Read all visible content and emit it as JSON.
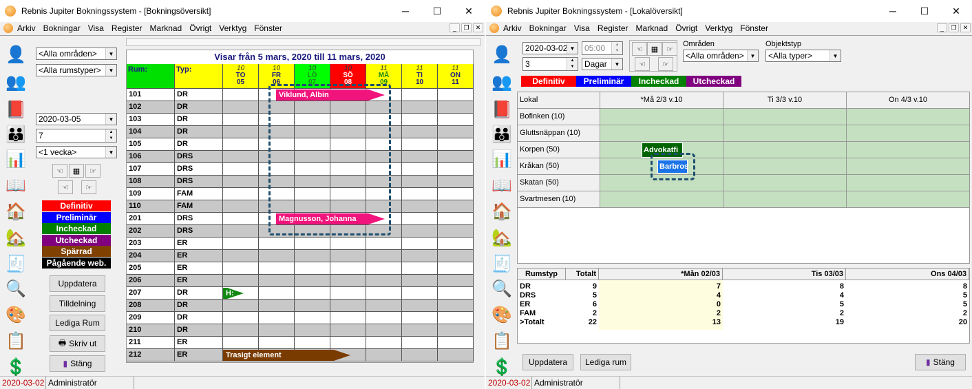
{
  "w1": {
    "title": "Rebnis Jupiter Bokningssystem - [Bokningsöversikt]",
    "menu": [
      "Arkiv",
      "Bokningar",
      "Visa",
      "Register",
      "Marknad",
      "Övrigt",
      "Verktyg",
      "Fönster"
    ],
    "filter_area": "<Alla områden>",
    "filter_roomtype": "<Alla rumstyper>",
    "date": "2020-03-05",
    "days": "7",
    "period": "<1 vecka>",
    "legend": [
      {
        "label": "Definitiv",
        "color": "#ff0000"
      },
      {
        "label": "Preliminär",
        "color": "#0000ff"
      },
      {
        "label": "Incheckad",
        "color": "#008000"
      },
      {
        "label": "Utcheckad",
        "color": "#800080"
      },
      {
        "label": "Spärrad",
        "color": "#804000"
      },
      {
        "label": "Pågående web.",
        "color": "#000000"
      }
    ],
    "buttons": [
      "Uppdatera",
      "Tilldelning",
      "Lediga Rum",
      "Skriv ut",
      "Stäng"
    ],
    "grid_title": "Visar från 5 mars, 2020 till 11 mars, 2020",
    "col_room": "Rum:",
    "col_type": "Typ:",
    "day_headers": [
      {
        "m": "10",
        "d": "TO",
        "n": "05",
        "bg": "#ffff00",
        "fg": "#1a1a80"
      },
      {
        "m": "10",
        "d": "FR",
        "n": "06",
        "bg": "#ffff00",
        "fg": "#1a1a80"
      },
      {
        "m": "10",
        "d": "LÖ",
        "n": "07",
        "bg": "#00ff00",
        "fg": "#1a8a1a"
      },
      {
        "m": "10",
        "d": "SÖ",
        "n": "08",
        "bg": "#ff0000",
        "fg": "#ffffff"
      },
      {
        "m": "11",
        "d": "MÅ",
        "n": "09",
        "bg": "#ffff00",
        "fg": "#1a8a1a"
      },
      {
        "m": "11",
        "d": "TI",
        "n": "10",
        "bg": "#ffff00",
        "fg": "#1a1a80"
      },
      {
        "m": "11",
        "d": "ON",
        "n": "11",
        "bg": "#ffff00",
        "fg": "#1a1a80"
      }
    ],
    "rooms": [
      {
        "r": "101",
        "t": "DR"
      },
      {
        "r": "102",
        "t": "DR"
      },
      {
        "r": "103",
        "t": "DR"
      },
      {
        "r": "104",
        "t": "DR"
      },
      {
        "r": "105",
        "t": "DR"
      },
      {
        "r": "106",
        "t": "DRS"
      },
      {
        "r": "107",
        "t": "DRS"
      },
      {
        "r": "108",
        "t": "DRS"
      },
      {
        "r": "109",
        "t": "FAM"
      },
      {
        "r": "110",
        "t": "FAM"
      },
      {
        "r": "201",
        "t": "DRS"
      },
      {
        "r": "202",
        "t": "DRS"
      },
      {
        "r": "203",
        "t": "ER"
      },
      {
        "r": "204",
        "t": "ER"
      },
      {
        "r": "205",
        "t": "ER"
      },
      {
        "r": "206",
        "t": "ER"
      },
      {
        "r": "207",
        "t": "DR"
      },
      {
        "r": "208",
        "t": "DR"
      },
      {
        "r": "209",
        "t": "DR"
      },
      {
        "r": "210",
        "t": "DR"
      },
      {
        "r": "211",
        "t": "ER"
      },
      {
        "r": "212",
        "t": "ER"
      }
    ],
    "bookings": {
      "b1": "Viklund, Albin",
      "b2": "Magnusson, Johanna",
      "b3": "H:",
      "b4": "Trasigt element"
    },
    "status_date": "2020-03-02",
    "status_user": "Administratör"
  },
  "w2": {
    "title": "Rebnis Jupiter Bokningssystem - [Lokalöversikt]",
    "menu": [
      "Arkiv",
      "Bokningar",
      "Visa",
      "Register",
      "Marknad",
      "Övrigt",
      "Verktyg",
      "Fönster"
    ],
    "date": "2020-03-02",
    "time": "05:00",
    "count": "3",
    "unit": "Dagar",
    "areas_label": "Områden",
    "areas_value": "<Alla områden>",
    "types_label": "Objektstyp",
    "types_value": "<Alla typer>",
    "legend": [
      {
        "label": "Definitiv",
        "color": "#ff0000"
      },
      {
        "label": "Preliminär",
        "color": "#0000ff"
      },
      {
        "label": "Incheckad",
        "color": "#008000"
      },
      {
        "label": "Utcheckad",
        "color": "#800080"
      }
    ],
    "col_lokal": "Lokal",
    "day_cols": [
      "*Må 2/3 v.10",
      "Ti 3/3 v.10",
      "On 4/3 v.10"
    ],
    "lokaler": [
      "Bofinken (10)",
      "Gluttsnäppan (10)",
      "Korpen (50)",
      "Kråkan (50)",
      "Skatan (50)",
      "Svartmesen (10)"
    ],
    "bookings": {
      "korpen": "Advokatfi",
      "krakan": "Barbros"
    },
    "sum_headers": [
      "Rumstyp",
      "Totalt",
      "*Mån 02/03",
      "Tis 03/03",
      "Ons 04/03"
    ],
    "sum_rows": [
      {
        "t": "DR",
        "tot": "9",
        "a": "7",
        "b": "8",
        "c": "8"
      },
      {
        "t": "DRS",
        "tot": "5",
        "a": "4",
        "b": "4",
        "c": "5"
      },
      {
        "t": "ER",
        "tot": "6",
        "a": "0",
        "b": "5",
        "c": "5"
      },
      {
        "t": "FAM",
        "tot": "2",
        "a": "2",
        "b": "2",
        "c": "2"
      },
      {
        "t": ">Totalt",
        "tot": "22",
        "a": "13",
        "b": "19",
        "c": "20"
      }
    ],
    "buttons": [
      "Uppdatera",
      "Lediga rum",
      "Stäng"
    ],
    "status_date": "2020-03-02",
    "status_user": "Administratör"
  }
}
